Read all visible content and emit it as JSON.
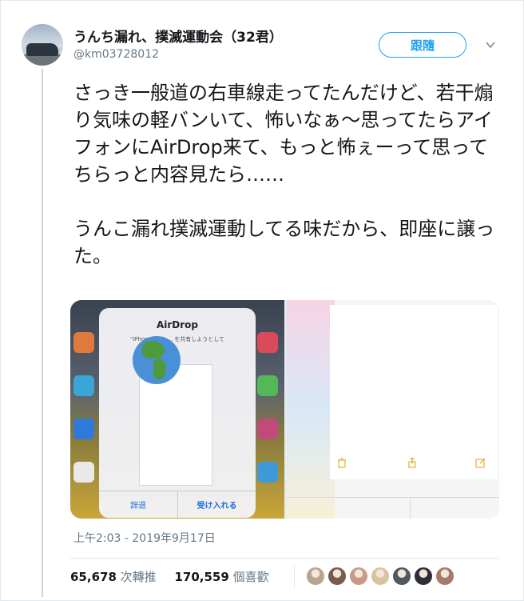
{
  "tweet": {
    "display_name": "うんち漏れ、撲滅運動会（32君）",
    "handle": "@km03728012",
    "follow_label": "跟隨",
    "text": "さっき一般道の右車線走ってたんだけど、若干煽り気味の軽バンいて、怖いなぁ〜思ってたらアイフォンにAirDrop来て、もっと怖ぇーって思ってちらっと内容見たら……\n\nうんこ漏れ撲滅運動してる味だから、即座に譲った。",
    "timestamp": "上午2:03 - 2019年9月17日",
    "retweets_count": "65,678",
    "retweets_label": "次轉推",
    "likes_count": "170,559",
    "likes_label": "個喜歡"
  },
  "media": {
    "airdrop_title": "AirDrop",
    "airdrop_subtitle": "\"iPhone\"から ... を共有しようとして",
    "decline_label": "辞退",
    "accept_label": "受け入れる"
  },
  "colors": {
    "accent": "#1da1f2",
    "text": "#14171a",
    "secondary": "#657786",
    "ios_link": "#1a6fd6"
  },
  "likers": [
    {
      "icon": "liker-avatar",
      "color": "#b9a48e"
    },
    {
      "icon": "liker-avatar",
      "color": "#7a5a4a"
    },
    {
      "icon": "liker-avatar",
      "color": "#c89a86"
    },
    {
      "icon": "liker-avatar",
      "color": "#d8c2a0"
    },
    {
      "icon": "liker-avatar",
      "color": "#505860"
    },
    {
      "icon": "liker-avatar",
      "color": "#2e2e34"
    },
    {
      "icon": "liker-avatar",
      "color": "#a67a6a"
    }
  ]
}
